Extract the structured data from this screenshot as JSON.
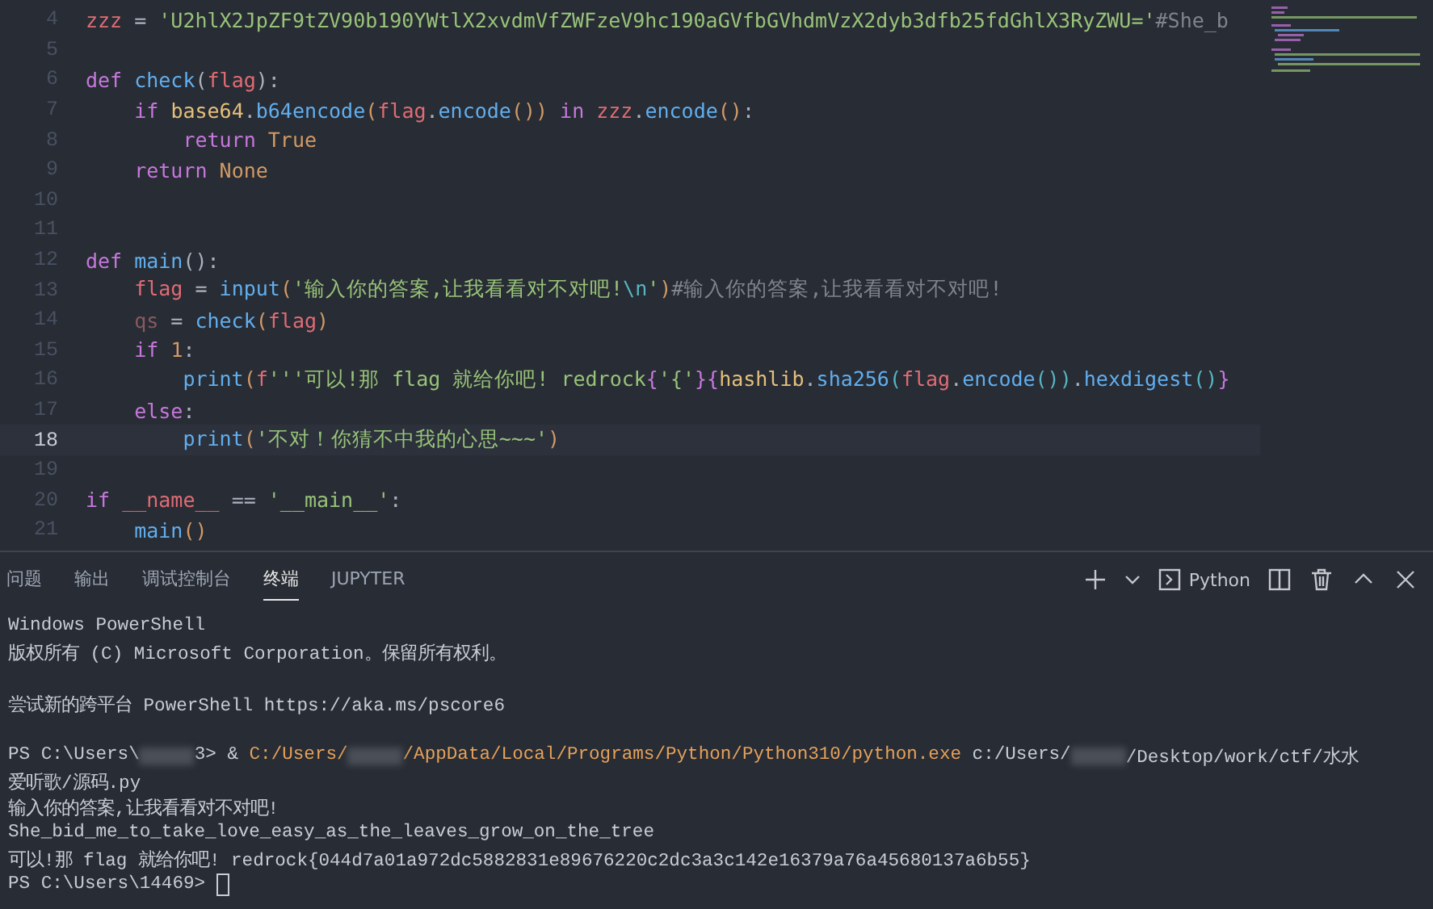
{
  "editor": {
    "lines": [
      {
        "number": "4",
        "selected": false,
        "tokens": [
          {
            "text": "zzz",
            "kind": "variable"
          },
          {
            "text": " = ",
            "kind": "plain"
          },
          {
            "text": "'U2hlX2JpZF9tZV90b190YWtlX2xvdmVfZWFzeV9hc190aGVfbGVhdmVzX2dyb3dfb25fdGhlX3RyZWU='",
            "kind": "string"
          },
          {
            "text": "#She_b",
            "kind": "comment"
          }
        ]
      },
      {
        "number": "5",
        "selected": false
      },
      {
        "number": "6",
        "selected": false,
        "tokens": [
          {
            "text": "def ",
            "kind": "keyword"
          },
          {
            "text": "check",
            "kind": "function"
          },
          {
            "text": "(",
            "kind": "plain"
          },
          {
            "text": "flag",
            "kind": "variable"
          },
          {
            "text": "):",
            "kind": "plain"
          }
        ]
      },
      {
        "number": "7",
        "selected": false,
        "tokens": [
          {
            "text": "    if ",
            "kind": "keyword"
          },
          {
            "text": "base64",
            "kind": "class"
          },
          {
            "text": ".",
            "kind": "plain"
          },
          {
            "text": "b64encode",
            "kind": "function"
          },
          {
            "text": "(",
            "kind": "bracket"
          },
          {
            "text": "flag",
            "kind": "variable"
          },
          {
            "text": ".",
            "kind": "plain"
          },
          {
            "text": "encode",
            "kind": "function"
          },
          {
            "text": "()) ",
            "kind": "bracket"
          },
          {
            "text": "in ",
            "kind": "keyword"
          },
          {
            "text": "zzz",
            "kind": "variable"
          },
          {
            "text": ".",
            "kind": "plain"
          },
          {
            "text": "encode",
            "kind": "function"
          },
          {
            "text": "()",
            "kind": "bracket"
          },
          {
            "text": ":",
            "kind": "plain"
          }
        ]
      },
      {
        "number": "8",
        "selected": false,
        "tokens": [
          {
            "text": "        return ",
            "kind": "keyword"
          },
          {
            "text": "True",
            "kind": "constant"
          }
        ]
      },
      {
        "number": "9",
        "selected": false,
        "tokens": [
          {
            "text": "    return ",
            "kind": "keyword"
          },
          {
            "text": "None",
            "kind": "constant"
          }
        ]
      },
      {
        "number": "10",
        "selected": false
      },
      {
        "number": "11",
        "selected": false
      },
      {
        "number": "12",
        "selected": false,
        "tokens": [
          {
            "text": "def ",
            "kind": "keyword"
          },
          {
            "text": "main",
            "kind": "function"
          },
          {
            "text": "():",
            "kind": "plain"
          }
        ]
      },
      {
        "number": "13",
        "selected": false,
        "tokens": [
          {
            "text": "    flag",
            "kind": "variable"
          },
          {
            "text": " = ",
            "kind": "plain"
          },
          {
            "text": "input",
            "kind": "function"
          },
          {
            "text": "(",
            "kind": "bracket"
          },
          {
            "text": "'输入你的答案,让我看看对不对吧!",
            "kind": "string"
          },
          {
            "text": "\\n",
            "kind": "escape"
          },
          {
            "text": "'",
            "kind": "string"
          },
          {
            "text": ")",
            "kind": "bracket"
          },
          {
            "text": "#输入你的答案,让我看看对不对吧!",
            "kind": "comment"
          }
        ]
      },
      {
        "number": "14",
        "selected": false,
        "tokens": [
          {
            "text": "    qs",
            "kind": "unused"
          },
          {
            "text": " = ",
            "kind": "plain"
          },
          {
            "text": "check",
            "kind": "function"
          },
          {
            "text": "(",
            "kind": "bracket"
          },
          {
            "text": "flag",
            "kind": "variable"
          },
          {
            "text": ")",
            "kind": "bracket"
          }
        ]
      },
      {
        "number": "15",
        "selected": false,
        "tokens": [
          {
            "text": "    if ",
            "kind": "keyword"
          },
          {
            "text": "1",
            "kind": "constant"
          },
          {
            "text": ":",
            "kind": "plain"
          }
        ]
      },
      {
        "number": "16",
        "selected": false,
        "tokens": [
          {
            "text": "        print",
            "kind": "function"
          },
          {
            "text": "(",
            "kind": "bracket"
          },
          {
            "text": "f",
            "kind": "variable"
          },
          {
            "text": "'''可以!那 flag 就给你吧! redrock",
            "kind": "string"
          },
          {
            "text": "{",
            "kind": "brace"
          },
          {
            "text": "'{'",
            "kind": "string"
          },
          {
            "text": "}{",
            "kind": "brace"
          },
          {
            "text": "hashlib",
            "kind": "class"
          },
          {
            "text": ".",
            "kind": "plain"
          },
          {
            "text": "sha256",
            "kind": "function"
          },
          {
            "text": "(",
            "kind": "brace2"
          },
          {
            "text": "flag",
            "kind": "variable"
          },
          {
            "text": ".",
            "kind": "plain"
          },
          {
            "text": "encode",
            "kind": "function"
          },
          {
            "text": "())",
            "kind": "brace2"
          },
          {
            "text": ".",
            "kind": "plain"
          },
          {
            "text": "hexdigest",
            "kind": "function"
          },
          {
            "text": "()",
            "kind": "brace2"
          },
          {
            "text": "}",
            "kind": "brace"
          }
        ]
      },
      {
        "number": "17",
        "selected": false,
        "tokens": [
          {
            "text": "    else",
            "kind": "keyword"
          },
          {
            "text": ":",
            "kind": "plain"
          }
        ]
      },
      {
        "number": "18",
        "selected": true,
        "tokens": [
          {
            "text": "        print",
            "kind": "function"
          },
          {
            "text": "(",
            "kind": "bracket"
          },
          {
            "text": "'不对！你猜不中我的心思~~~'",
            "kind": "string"
          },
          {
            "text": ")",
            "kind": "bracket"
          }
        ]
      },
      {
        "number": "19",
        "selected": false
      },
      {
        "number": "20",
        "selected": false,
        "tokens": [
          {
            "text": "if ",
            "kind": "keyword"
          },
          {
            "text": "__name__",
            "kind": "variable"
          },
          {
            "text": " == ",
            "kind": "plain"
          },
          {
            "text": "'__main__'",
            "kind": "string"
          },
          {
            "text": ":",
            "kind": "plain"
          }
        ]
      },
      {
        "number": "21",
        "selected": false,
        "tokens": [
          {
            "text": "    main",
            "kind": "function"
          },
          {
            "text": "()",
            "kind": "bracket"
          }
        ]
      }
    ]
  },
  "panel": {
    "tabs": [
      {
        "label": "问题",
        "selected": false
      },
      {
        "label": "输出",
        "selected": false
      },
      {
        "label": "调试控制台",
        "selected": false
      },
      {
        "label": "终端",
        "selected": true
      },
      {
        "label": "JUPYTER",
        "selected": false
      }
    ],
    "terminal_name": "Python",
    "terminal": [
      {
        "kind": "output",
        "segments": [
          {
            "text": "Windows PowerShell",
            "kind": "plain"
          }
        ]
      },
      {
        "kind": "output",
        "segments": [
          {
            "text": "版权所有 (C) Microsoft Corporation。保留所有权利。",
            "kind": "plain"
          }
        ]
      },
      {
        "kind": "blank"
      },
      {
        "kind": "output",
        "segments": [
          {
            "text": "尝试新的跨平台 PowerShell https://aka.ms/pscore6",
            "kind": "plain"
          }
        ]
      },
      {
        "kind": "blank"
      },
      {
        "kind": "output",
        "segments": [
          {
            "text": "PS C:\\Users\\",
            "kind": "plain"
          },
          {
            "kind": "redacted"
          },
          {
            "text": "3> & ",
            "kind": "plain"
          },
          {
            "text": "C:/Users/",
            "kind": "path"
          },
          {
            "kind": "redacted"
          },
          {
            "text": "/AppData/Local/Programs/Python/Python310/python.exe",
            "kind": "path"
          },
          {
            "text": " c:/Users/",
            "kind": "plain"
          },
          {
            "kind": "redacted"
          },
          {
            "text": "/Desktop/work/ctf/水水",
            "kind": "plain"
          }
        ]
      },
      {
        "kind": "output",
        "segments": [
          {
            "text": "爱听歌/源码.py",
            "kind": "plain"
          }
        ]
      },
      {
        "kind": "output",
        "segments": [
          {
            "text": "输入你的答案,让我看看对不对吧!",
            "kind": "plain"
          }
        ]
      },
      {
        "kind": "output",
        "segments": [
          {
            "text": "She_bid_me_to_take_love_easy_as_the_leaves_grow_on_the_tree",
            "kind": "plain"
          }
        ]
      },
      {
        "kind": "output",
        "segments": [
          {
            "text": "可以!那 flag 就给你吧! redrock{044d7a01a972dc5882831e89676220c2dc3a3c142e16379a76a45680137a6b55}",
            "kind": "plain"
          }
        ]
      },
      {
        "kind": "output",
        "segments": [
          {
            "text": "PS C:\\Users\\14469> ",
            "kind": "plain"
          },
          {
            "kind": "cursor"
          }
        ]
      }
    ]
  }
}
